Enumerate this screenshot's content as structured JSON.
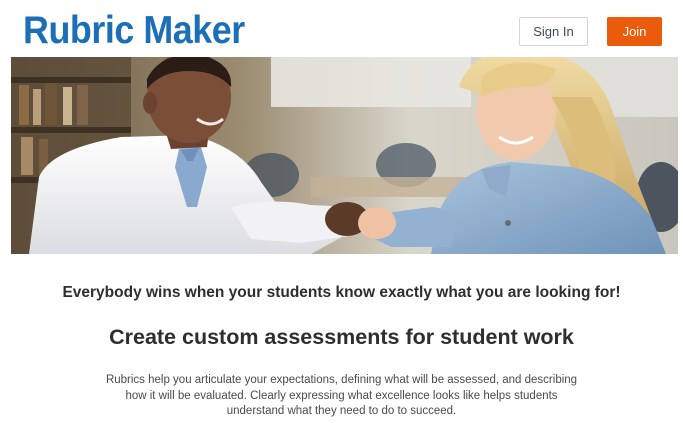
{
  "header": {
    "logo_text": "Rubric Maker",
    "signin_label": "Sign In",
    "join_label": "Join"
  },
  "hero": {
    "image_description": "teacher-and-student-fist-bump-photo"
  },
  "main": {
    "tagline": "Everybody wins when your students know exactly what you are looking for!",
    "headline": "Create custom assessments for student work",
    "description": "Rubrics help you articulate your expectations, defining what will be assessed, and describing how it will be evaluated. Clearly expressing what excellence looks like helps students understand what they need to do to succeed."
  },
  "colors": {
    "brand_blue": "#1b6fb6",
    "join_orange": "#ea5b0c",
    "text_dark": "#2e2e2e"
  }
}
